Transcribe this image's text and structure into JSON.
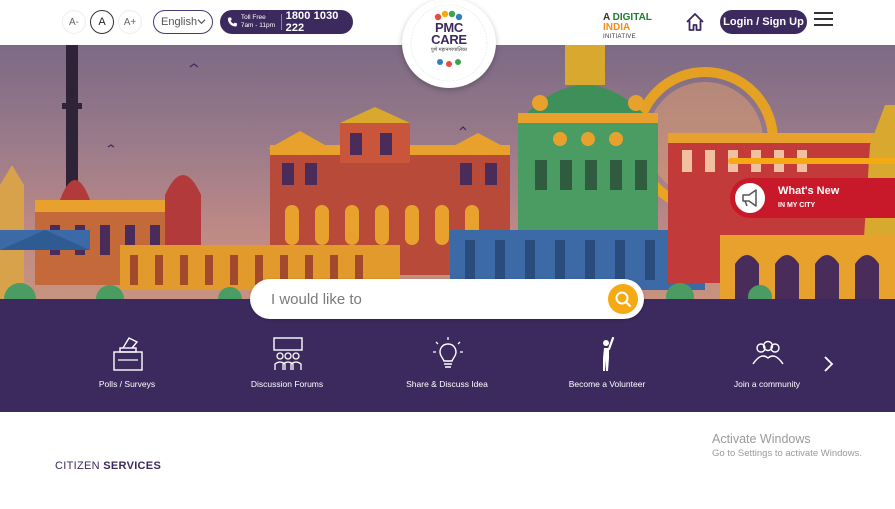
{
  "header": {
    "font_small": "A-",
    "font_normal": "A",
    "font_large": "A+",
    "language": "English",
    "tollfree_label": "Toll Free",
    "tollfree_hours": "7am - 11pm",
    "tollfree_number": "1800 1030 222",
    "logo_title_line1": "PMC",
    "logo_title_line2": "CARE",
    "logo_tagline": "पुणे महानगरपालिका",
    "digital_india_a": "A",
    "digital_india_digital": "DIGITAL",
    "digital_india_india": "INDIA",
    "digital_india_sub": "INITIATIVE",
    "login_label": "Login / Sign Up"
  },
  "whats_new": {
    "title": "What's New",
    "subtitle": "IN MY CITY"
  },
  "search": {
    "placeholder": "I would like to"
  },
  "quick_links": [
    {
      "label": "Polls / Surveys",
      "icon": "ballot-box-icon"
    },
    {
      "label": "Discussion Forums",
      "icon": "forum-people-icon"
    },
    {
      "label": "Share & Discuss Idea",
      "icon": "lightbulb-icon"
    },
    {
      "label": "Become a Volunteer",
      "icon": "volunteer-hand-raised-icon"
    },
    {
      "label": "Join a community",
      "icon": "community-group-icon"
    }
  ],
  "section": {
    "citizen_prefix": "CITIZEN",
    "citizen_bold": "SERVICES"
  },
  "watermark": {
    "line1": "Activate Windows",
    "line2": "Go to Settings to activate Windows."
  },
  "colors": {
    "primary": "#3c2a5e",
    "accent": "#f5a912",
    "alert": "#c8192a"
  }
}
